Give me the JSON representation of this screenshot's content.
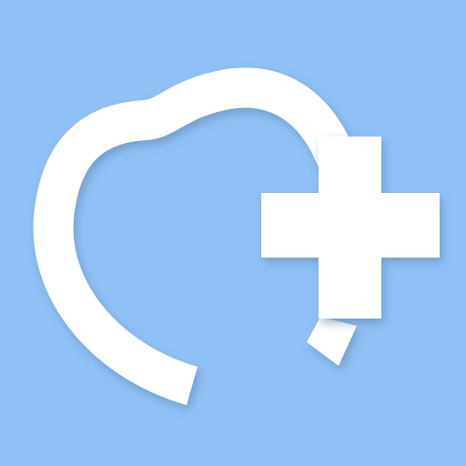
{
  "icon": {
    "name": "dental-care-icon",
    "background_color": "#8fc1f6",
    "glyph_color": "#ffffff",
    "shadow_color": "#5e87b0",
    "elements": [
      "tooth-outline-icon",
      "plus-cross-icon"
    ]
  }
}
